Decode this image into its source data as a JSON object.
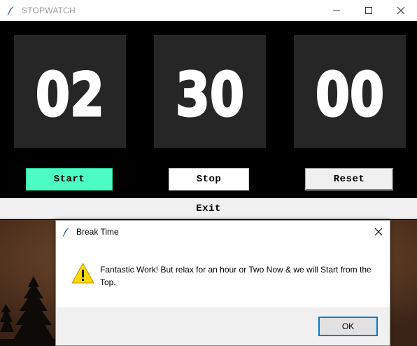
{
  "window": {
    "title": "STOPWATCH",
    "icon": "feather-icon",
    "controls": [
      "minimize-icon",
      "maximize-icon",
      "close-icon"
    ]
  },
  "stopwatch": {
    "hours": "02",
    "minutes": "30",
    "seconds": "00",
    "digit_color": "#ffffff",
    "box_color": "#262626"
  },
  "buttons": {
    "start": "Start",
    "stop": "Stop",
    "reset": "Reset",
    "exit": "Exit",
    "start_color": "#4cfcc2"
  },
  "dialog": {
    "title": "Break Time",
    "icon": "warning-icon",
    "message": "Fantastic Work! But relax for an hour or Two Now & we will Start from the Top.",
    "ok_label": "OK",
    "ok_border_color": "#0078d7"
  }
}
